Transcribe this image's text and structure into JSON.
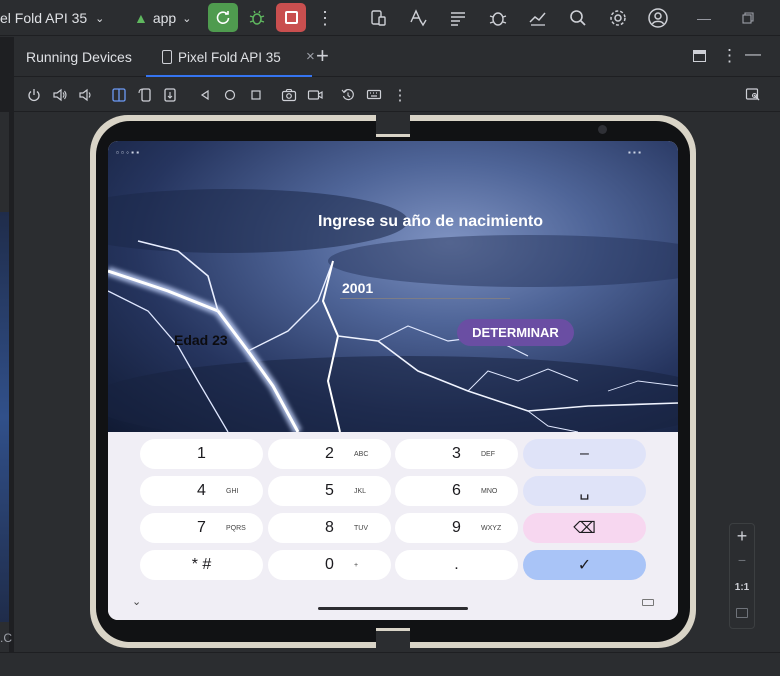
{
  "topbar": {
    "project": "el Fold API 35",
    "config": "app"
  },
  "toolwindow": {
    "title": "Running Devices",
    "tab_label": "Pixel Fold API 35",
    "tab_close": "×",
    "add": "+"
  },
  "app": {
    "heading": "Ingrese su año de nacimiento",
    "year_value": "2001",
    "age_text": "Edad 23",
    "button_label": "DETERMINAR"
  },
  "keypad": {
    "rows": [
      [
        {
          "main": "1",
          "sub": ""
        },
        {
          "main": "2",
          "sub": "ABC"
        },
        {
          "main": "3",
          "sub": "DEF"
        },
        {
          "main": "–",
          "sub": ""
        }
      ],
      [
        {
          "main": "4",
          "sub": "GHI"
        },
        {
          "main": "5",
          "sub": "JKL"
        },
        {
          "main": "6",
          "sub": "MNO"
        },
        {
          "main": "␣",
          "sub": ""
        }
      ],
      [
        {
          "main": "7",
          "sub": "PQRS"
        },
        {
          "main": "8",
          "sub": "TUV"
        },
        {
          "main": "9",
          "sub": "WXYZ"
        },
        {
          "main": "⌫",
          "sub": ""
        }
      ],
      [
        {
          "main": "* #",
          "sub": ""
        },
        {
          "main": "0",
          "sub": "+"
        },
        {
          "main": ".",
          "sub": ""
        },
        {
          "main": "✓",
          "sub": ""
        }
      ]
    ]
  },
  "zoom": {
    "in": "+",
    "out": "−",
    "actual": "1:1"
  },
  "colors": {
    "accent": "#3574f0",
    "run": "#4f9b4f",
    "stop": "#c94f4f",
    "button": "#6a4ea3"
  }
}
